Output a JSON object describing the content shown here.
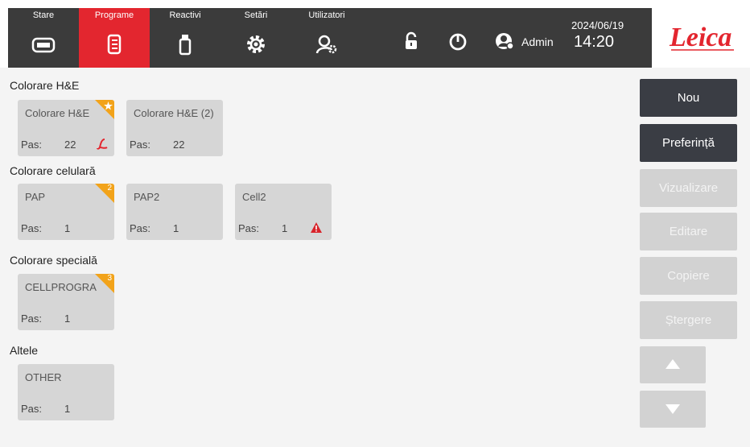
{
  "nav": {
    "tabs": [
      {
        "label": "Stare",
        "icon": "instrument-icon"
      },
      {
        "label": "Programe",
        "icon": "program-list-icon",
        "active": true
      },
      {
        "label": "Reactivi",
        "icon": "reagent-bottle-icon"
      },
      {
        "label": "Setări",
        "icon": "settings-gear-icon"
      },
      {
        "label": "Utilizatori",
        "icon": "users-gear-icon"
      }
    ],
    "accent": "#e3262f"
  },
  "header": {
    "user": "Admin",
    "date": "2024/06/19",
    "time": "14:20",
    "icons": [
      "unlock-icon",
      "power-icon",
      "user-admin-icon"
    ]
  },
  "brand": {
    "logo_text": "Leica",
    "logo_color": "#e3262f"
  },
  "groups": [
    {
      "title": "Colorare H&E",
      "programs": [
        {
          "name": "Colorare H&E",
          "pas": "Pas:",
          "steps": "22",
          "corner": "star",
          "mark": "leica-icon"
        },
        {
          "name": "Colorare H&E (2)",
          "pas": "Pas:",
          "steps": "22"
        }
      ]
    },
    {
      "title": "Colorare celulară",
      "programs": [
        {
          "name": "PAP",
          "pas": "Pas:",
          "steps": "1",
          "corner": "2"
        },
        {
          "name": "PAP2",
          "pas": "Pas:",
          "steps": "1"
        },
        {
          "name": "Cell2",
          "pas": "Pas:",
          "steps": "1",
          "mark": "warning-icon"
        }
      ]
    },
    {
      "title": "Colorare specială",
      "programs": [
        {
          "name": "CELLPROGRA",
          "pas": "Pas:",
          "steps": "1",
          "corner": "3"
        }
      ]
    },
    {
      "title": "Altele",
      "programs": [
        {
          "name": "OTHER",
          "pas": "Pas:",
          "steps": "1"
        }
      ]
    }
  ],
  "actions": [
    {
      "label": "Nou",
      "enabled": true
    },
    {
      "label": "Preferință",
      "enabled": true
    },
    {
      "label": "Vizualizare",
      "enabled": false
    },
    {
      "label": "Editare",
      "enabled": false
    },
    {
      "label": "Copiere",
      "enabled": false
    },
    {
      "label": "Ștergere",
      "enabled": false
    }
  ],
  "scroll": {
    "up_icon": "arrow-up-icon",
    "down_icon": "arrow-down-icon"
  },
  "colors": {
    "corner_badge": "#f2a31a",
    "warning": "#d8232a",
    "dark_button": "#3a3d44"
  }
}
